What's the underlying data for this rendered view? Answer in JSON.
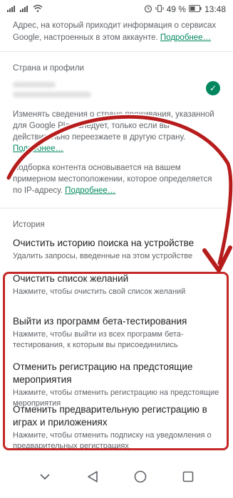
{
  "status": {
    "battery": "49 %",
    "time": "13:48"
  },
  "intro": {
    "text": "Адрес, на который приходит информация о сервисах Google, настроенных в этом аккаунте.",
    "link": "Подробнее…"
  },
  "country": {
    "section_title": "Страна и профили",
    "change_text": "Изменять сведения о стране проживания, указанной для Google Play, следует, только если вы действительно переезжаете в другую страну.",
    "change_link": "Подробнее…",
    "filter_text": "Подборка контента основывается на вашем примерном местоположении, которое определяется по IP-адресу.",
    "filter_link": "Подробнее…"
  },
  "history": {
    "section_title": "История",
    "items": [
      {
        "title": "Очистить историю поиска на устройстве",
        "subtitle": "Удалить запросы, введенные на этом устройстве"
      },
      {
        "title": "Очистить список желаний",
        "subtitle": "Нажмите, чтобы очистить свой список желаний"
      },
      {
        "title": "Выйти из программ бета-тестирования",
        "subtitle": "Нажмите, чтобы выйти из всех программ бета-тестирования, к которым вы присоединились"
      },
      {
        "title": "Отменить регистрацию на предстоящие мероприятия",
        "subtitle": "Нажмите, чтобы отменить регистрацию на предстоящие мероприятия"
      },
      {
        "title": "Отменить предварительную регистрацию в играх и приложениях",
        "subtitle": "Нажмите, чтобы отменить подписку на уведомления о предварительных регистрациях"
      }
    ]
  },
  "colors": {
    "accent_green": "#01875f",
    "highlight_red": "#c62828"
  },
  "icons": {
    "nav": [
      "chevron-down-icon",
      "back-icon",
      "home-icon",
      "recents-icon"
    ]
  }
}
